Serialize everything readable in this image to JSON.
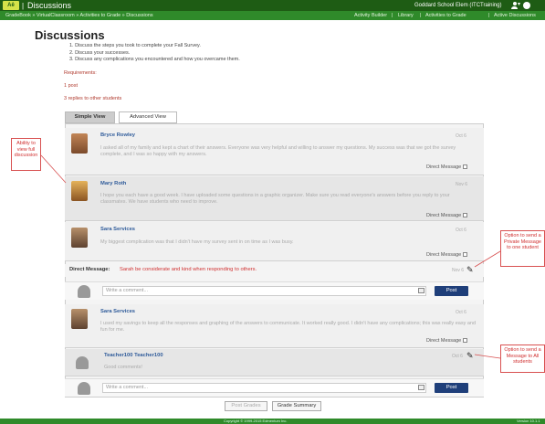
{
  "app": {
    "logo": "Aê",
    "title": "Discussions",
    "org": "Goddard School Elem (ITCTraining)"
  },
  "breadcrumb": "GradeBook » VirtualClassroom » Activities to Grade » Discussions",
  "nav": [
    "Activity Builder",
    "Library",
    "Activities to Grade",
    "Active Discussions"
  ],
  "page": {
    "title": "Discussions",
    "steps": [
      "1.  Discuss the steps you took to complete your Fall Survey.",
      "2.  Discuss your successes.",
      "3.  Discuss any complications you encountered and how you overcame them."
    ],
    "requirements_label": "Requirements:",
    "req1": "1 post",
    "req2": "3 replies to other students"
  },
  "tabs": {
    "simple": "Simple View",
    "advanced": "Advanced View"
  },
  "posts": [
    {
      "name": "Bryce Rowley",
      "time": "Oct 6",
      "body": "I asked all of my family and kept a chart of their answers. Everyone was very helpful and willing to answer my questions. My success was that we got the survey complete, and I was so happy with my answers.",
      "dm": "Direct Message"
    },
    {
      "name": "Mary Roth",
      "time": "Nov 6",
      "body": "I hope you each have a good week. I have uploaded some questions in a graphic organizer. Make sure you read everyone's answers before you reply to your classmates. We have students who need to improve.",
      "dm": "Direct Message"
    },
    {
      "name": "Sara Services",
      "time": "Oct 6",
      "body": "My biggest complication was that I didn't have my survey sent in on time as I was busy.",
      "dm": "Direct Message"
    }
  ],
  "direct_message": {
    "label": "Direct Message:",
    "text": "Sarah be considerate and kind when responding to others.",
    "time": "Nov 6"
  },
  "comment": {
    "placeholder": "Write a comment...",
    "post": "Post"
  },
  "post4": {
    "name": "Sara Services",
    "time": "Oct 6",
    "body": "I used my savings to keep all the responses and graphing of the answers to communicate. It worked really good. I didn't have any complications; this was really easy and fun for me.",
    "dm": "Direct Message"
  },
  "teacher": {
    "name": "Teacher100 Teacher100",
    "time": "Oct 6",
    "body": "Good comments!"
  },
  "buttons": {
    "post_grades": "Post Grades",
    "grade_summary": "Grade Summary"
  },
  "footer": {
    "copyright": "Copyright © 1999-2015 Edmentum Inc.",
    "version": "Version 10.1.1"
  },
  "callouts": {
    "left": "Ability to view full discussion",
    "right1": "Option to send a Private Message to one student",
    "right2": "Option to send a Message to All students"
  },
  "colors": {
    "green_dark": "#1e5c14",
    "green": "#2f8a2a",
    "post_button": "#1f3f7a",
    "callout": "#d03030"
  }
}
